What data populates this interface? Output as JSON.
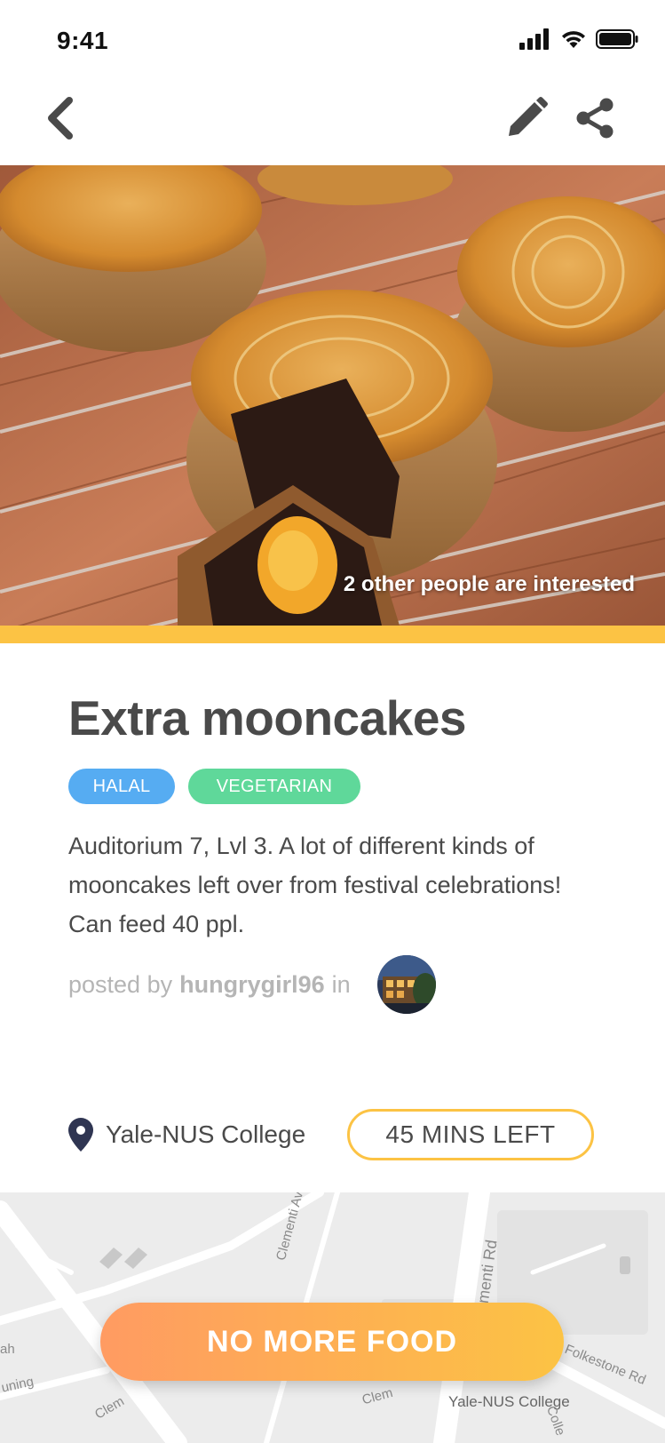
{
  "status_bar": {
    "time": "9:41"
  },
  "nav": {
    "back_icon": "chevron-left-icon",
    "edit_icon": "pencil-icon",
    "share_icon": "share-icon"
  },
  "hero": {
    "image": "mooncakes-photo",
    "caption": "2 other people are interested"
  },
  "post": {
    "title": "Extra mooncakes",
    "tags": [
      "HALAL",
      "VEGETARIAN"
    ],
    "description": "Auditorium 7, Lvl 3. A lot of different kinds of mooncakes left over from festival celebrations! Can feed 40 ppl.",
    "posted_by_prefix": "posted by",
    "username": "hungrygirl96",
    "posted_in": "in"
  },
  "location": {
    "name": "Yale-NUS College",
    "time_left": "45 MINS LEFT"
  },
  "map": {
    "labels": [
      "Clementi Ave",
      "Clementi Rd",
      "Folkestone Rd",
      "Yale-NUS College",
      "Clem",
      "Clem",
      "Colle",
      "ah",
      "uning"
    ]
  },
  "cta": {
    "label": "NO MORE FOOD"
  },
  "colors": {
    "accent": "#fcc344",
    "halal": "#56acf2",
    "vegetarian": "#5fd89a",
    "cta_start": "#ff9b62",
    "cta_end": "#fcc344",
    "text": "#4a4a4a"
  }
}
